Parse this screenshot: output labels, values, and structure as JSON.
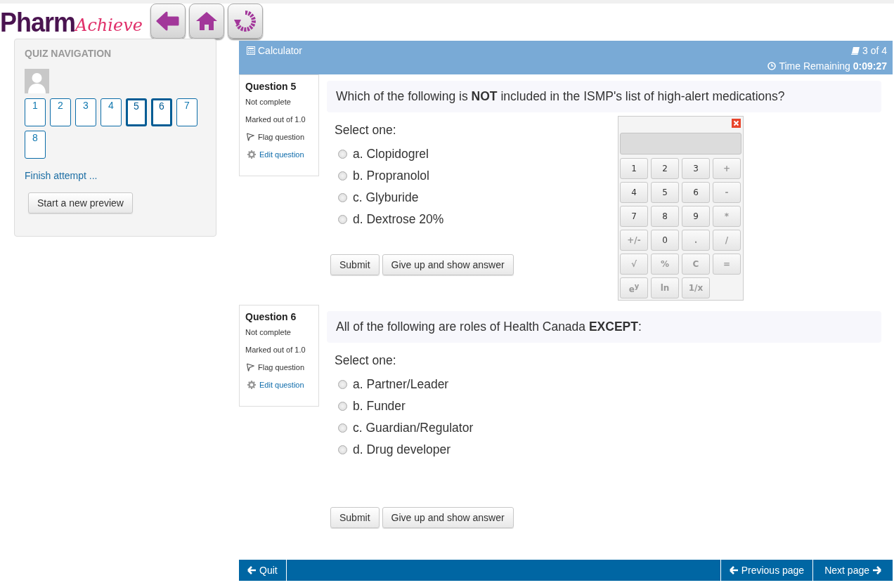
{
  "header": {
    "logo": {
      "part1": "Pharm",
      "part2": "Achieve"
    }
  },
  "quiz_navigation": {
    "title": "QUIZ NAVIGATION",
    "buttons": [
      {
        "label": "1",
        "selected": false
      },
      {
        "label": "2",
        "selected": false
      },
      {
        "label": "3",
        "selected": false
      },
      {
        "label": "4",
        "selected": false
      },
      {
        "label": "5",
        "selected": true
      },
      {
        "label": "6",
        "selected": true
      },
      {
        "label": "7",
        "selected": false
      },
      {
        "label": "8",
        "selected": false
      }
    ],
    "finish_link": "Finish attempt ...",
    "new_preview_button": "Start a new preview"
  },
  "top_bar": {
    "calculator": "Calculator",
    "page_count": "3 of 4",
    "time_remaining": "Time Remaining **0:09:27**"
  },
  "questions": [
    {
      "title": "Question 5",
      "status": "Not complete",
      "marks": "Marked out of 1.0",
      "flag": "Flag question",
      "edit": "Edit question",
      "text": "Which of the following is **NOT** included in the ISMP's list of high-alert medications?",
      "prompt": "Select one:",
      "options": [
        {
          "label": "a. Clopidogrel",
          "checked": false
        },
        {
          "label": "b. Propranolol",
          "checked": false
        },
        {
          "label": "c. Glyburide",
          "checked": false
        },
        {
          "label": "d. Dextrose 20%",
          "checked": false
        }
      ],
      "buttons": [
        "Submit",
        "Give up and show answer"
      ]
    },
    {
      "title": "Question 6",
      "status": "Not complete",
      "marks": "Marked out of 1.0",
      "flag": "Flag question",
      "edit": "Edit question",
      "text": "All of the following are roles of Health Canada **EXCEPT**:",
      "prompt": "Select one:",
      "options": [
        {
          "label": "a. Partner/Leader",
          "checked": false
        },
        {
          "label": "b. Funder",
          "checked": false
        },
        {
          "label": "c. Guardian/Regulator",
          "checked": false
        },
        {
          "label": "d. Drug developer",
          "checked": false
        }
      ],
      "buttons": [
        "Submit",
        "Give up and show answer"
      ]
    }
  ],
  "calculator": {
    "keys": [
      "1",
      "2",
      "3",
      "+",
      "4",
      "5",
      "6",
      "-",
      "7",
      "8",
      "9",
      "*",
      "+/-",
      "0",
      ".",
      "/",
      "√",
      "%",
      "C",
      "=",
      "e$^{y}$",
      "ln",
      "1/x"
    ]
  },
  "footer": {
    "quit": "Quit",
    "previous": "Previous page",
    "next": "Next page"
  }
}
